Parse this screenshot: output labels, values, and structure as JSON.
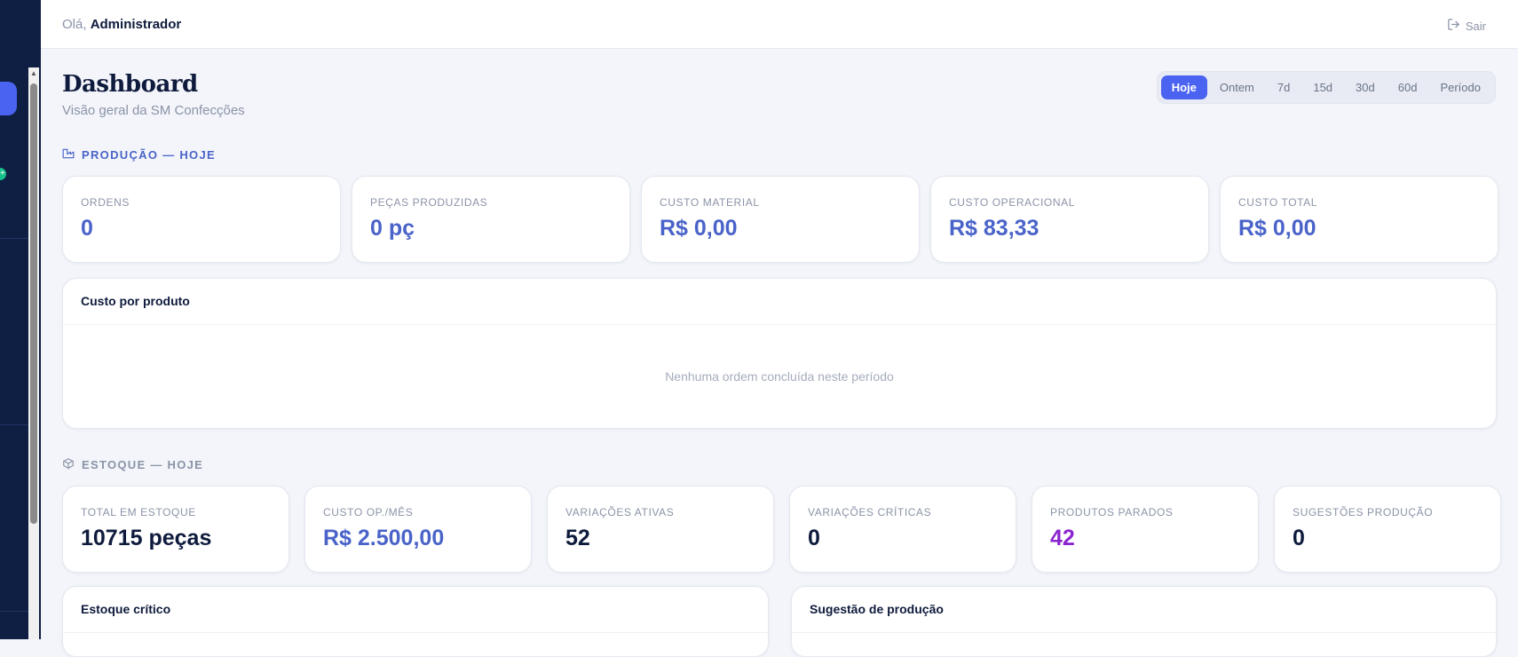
{
  "header": {
    "greeting_prefix": "Olá,",
    "user_name": "Administrador",
    "logout_label": "Sair"
  },
  "page": {
    "title": "Dashboard",
    "subtitle": "Visão geral da SM Confecções"
  },
  "date_range": {
    "options": [
      "Hoje",
      "Ontem",
      "7d",
      "15d",
      "30d",
      "60d",
      "Período"
    ],
    "selected": "Hoje"
  },
  "production": {
    "section_label": "PRODUÇÃO — HOJE",
    "kpis": [
      {
        "label": "ORDENS",
        "value": "0"
      },
      {
        "label": "PEÇAS PRODUZIDAS",
        "value": "0 pç"
      },
      {
        "label": "CUSTO MATERIAL",
        "value": "R$ 0,00"
      },
      {
        "label": "CUSTO OPERACIONAL",
        "value": "R$ 83,33"
      },
      {
        "label": "CUSTO TOTAL",
        "value": "R$ 0,00"
      }
    ],
    "cost_panel": {
      "title": "Custo por produto",
      "empty_message": "Nenhuma ordem concluída neste período"
    }
  },
  "stock": {
    "section_label": "ESTOQUE — HOJE",
    "kpis": [
      {
        "label": "TOTAL EM ESTOQUE",
        "value": "10715 peças"
      },
      {
        "label": "CUSTO OP./MÊS",
        "value": "R$ 2.500,00"
      },
      {
        "label": "VARIAÇÕES ATIVAS",
        "value": "52"
      },
      {
        "label": "VARIAÇÕES CRÍTICAS",
        "value": "0"
      },
      {
        "label": "PRODUTOS PARADOS",
        "value": "42"
      },
      {
        "label": "SUGESTÕES PRODUÇÃO",
        "value": "0"
      }
    ],
    "critical_panel_title": "Estoque crítico",
    "suggestion_panel_title": "Sugestão de produção"
  },
  "colors": {
    "accent": "#4a63f0",
    "sidebar": "#0f1f44",
    "kpi_blue": "#4a63c9",
    "kpi_purple": "#8a25cf",
    "success": "#16c08a"
  }
}
